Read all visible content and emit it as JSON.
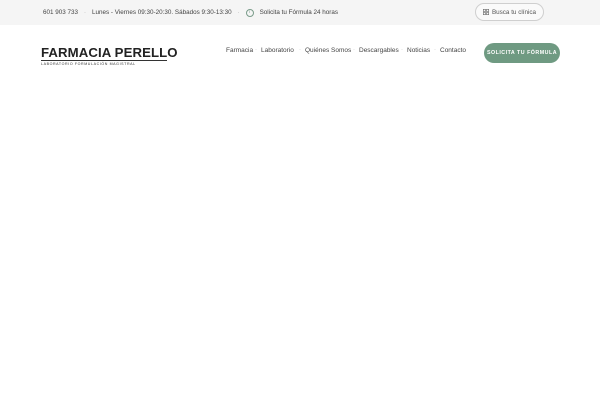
{
  "topbar": {
    "phone": "601 903 733",
    "hours": "Lunes - Viernes 09:30-20:30. Sábados 9:30-13:30",
    "separator": "·",
    "info_text": "Solicita tu Fórmula 24 horas",
    "clinic_button_label": "Busca tu clínica"
  },
  "header": {
    "logo_title": "FARMACIA PERELLO",
    "logo_subtitle": "LABORATORIO FORMULACIÓN MAGISTRAL",
    "nav": [
      {
        "label": "Farmacia"
      },
      {
        "label": "Laboratorio"
      },
      {
        "label": "Quiénes Somos"
      },
      {
        "label": "Descargables"
      },
      {
        "label": "Noticias"
      },
      {
        "label": "Contacto"
      }
    ],
    "nav_separator": "·",
    "cta_label": "SOLICITA TU FÓRMULA"
  },
  "colors": {
    "accent": "#6f9a82",
    "topbar_bg": "#f5f5f5",
    "text": "#444444"
  }
}
